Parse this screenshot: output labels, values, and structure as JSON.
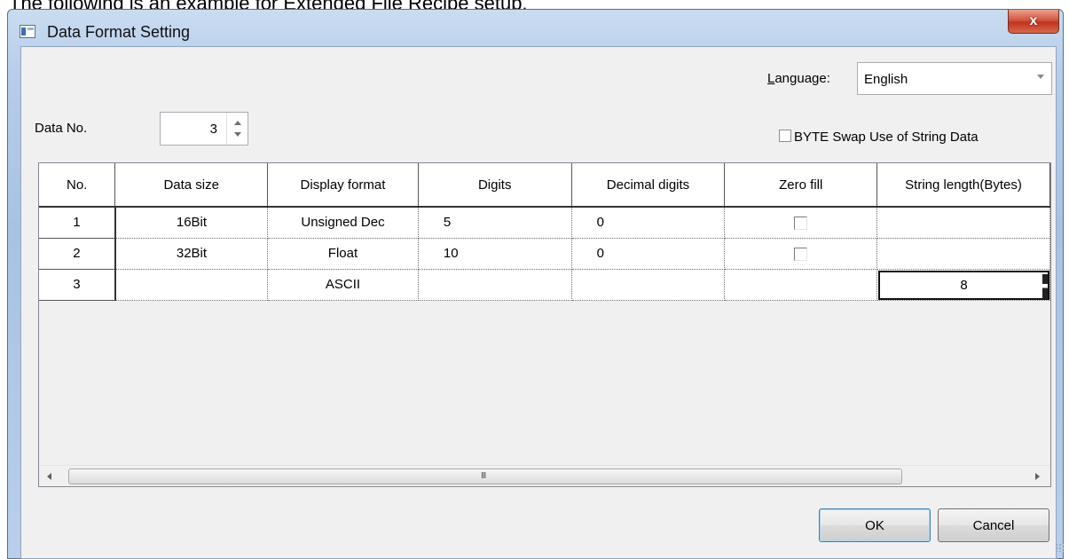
{
  "caption": "The following is an example for Extended File Recipe setup.",
  "window": {
    "title": "Data Format Setting",
    "close_label": "x"
  },
  "language": {
    "label_accel": "L",
    "label_rest": "anguage:",
    "value": "English"
  },
  "byte_swap": {
    "label": "BYTE Swap Use of String Data",
    "checked": false
  },
  "data_no": {
    "label": "Data No.",
    "value": "3"
  },
  "table": {
    "columns": [
      "No.",
      "Data size",
      "Display format",
      "Digits",
      "Decimal digits",
      "Zero fill",
      "String length(Bytes)"
    ],
    "rows": [
      {
        "no": "1",
        "data_size": "16Bit",
        "display_format": "Unsigned Dec",
        "digits": "5",
        "decimal_digits": "0",
        "zero_fill": false,
        "string_length": ""
      },
      {
        "no": "2",
        "data_size": "32Bit",
        "display_format": "Float",
        "digits": "10",
        "decimal_digits": "0",
        "zero_fill": false,
        "string_length": ""
      },
      {
        "no": "3",
        "data_size": "",
        "display_format": "ASCII",
        "digits": "",
        "decimal_digits": "",
        "zero_fill": null,
        "string_length": "8"
      }
    ],
    "scroll_grip": "III"
  },
  "buttons": {
    "ok": "OK",
    "cancel": "Cancel"
  },
  "colors": {
    "title_gradient": "#b7cde8",
    "close_button": "#c1341d",
    "client_background": "#f0f0f0"
  }
}
